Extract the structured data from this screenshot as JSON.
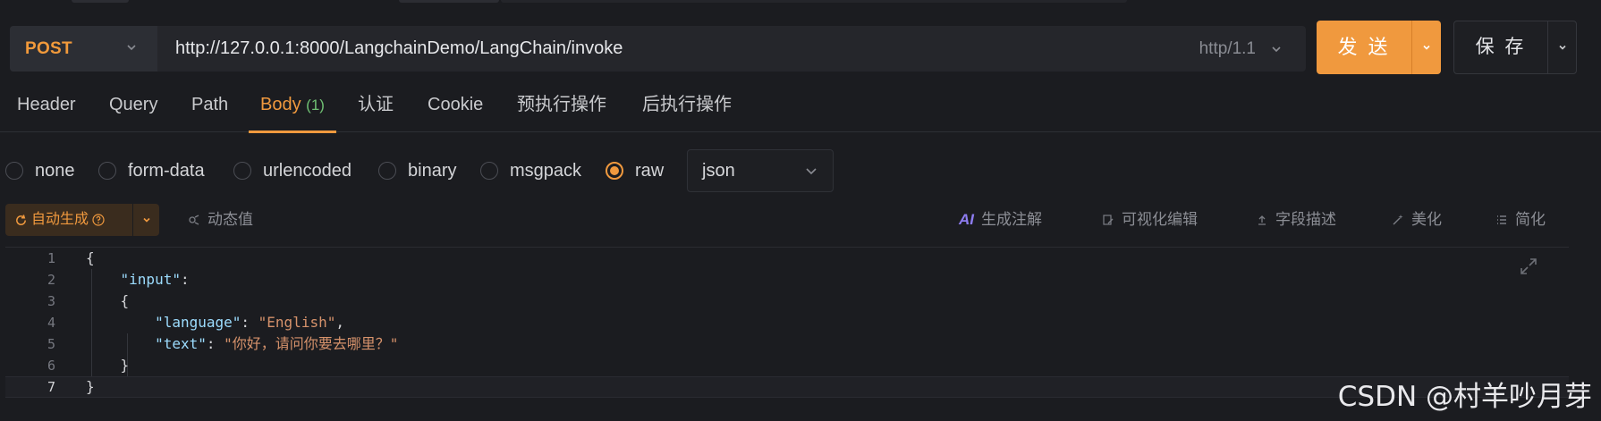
{
  "request": {
    "method": "POST",
    "url": "http://127.0.0.1:8000/LangchainDemo/LangChain/invoke",
    "protocol": "http/1.1",
    "send_label": "发 送",
    "save_label": "保 存"
  },
  "tabs": [
    {
      "label": "Header"
    },
    {
      "label": "Query"
    },
    {
      "label": "Path"
    },
    {
      "label": "Body",
      "count": "(1)",
      "active": true
    },
    {
      "label": "认证"
    },
    {
      "label": "Cookie"
    },
    {
      "label": "预执行操作"
    },
    {
      "label": "后执行操作"
    }
  ],
  "body_types": [
    {
      "label": "none"
    },
    {
      "label": "form-data"
    },
    {
      "label": "urlencoded"
    },
    {
      "label": "binary"
    },
    {
      "label": "msgpack"
    },
    {
      "label": "raw",
      "selected": true
    }
  ],
  "format_select": "json",
  "toolbar": {
    "auto_generate": "自动生成",
    "dynamic_value": "动态值",
    "ai_label": "AI",
    "generate_comment": "生成注解",
    "visual_edit": "可视化编辑",
    "field_desc": "字段描述",
    "beautify": "美化",
    "simplify": "简化"
  },
  "editor": {
    "line_numbers": [
      "1",
      "2",
      "3",
      "4",
      "5",
      "6",
      "7"
    ],
    "lines": [
      {
        "indent": "",
        "parts": [
          {
            "t": "{",
            "c": "p"
          }
        ]
      },
      {
        "indent": "    ",
        "parts": [
          {
            "t": "\"input\"",
            "c": "k"
          },
          {
            "t": ":",
            "c": "p"
          }
        ]
      },
      {
        "indent": "    ",
        "parts": [
          {
            "t": "{",
            "c": "p"
          }
        ]
      },
      {
        "indent": "        ",
        "parts": [
          {
            "t": "\"language\"",
            "c": "k"
          },
          {
            "t": ": ",
            "c": "p"
          },
          {
            "t": "\"English\"",
            "c": "s"
          },
          {
            "t": ",",
            "c": "p"
          }
        ]
      },
      {
        "indent": "        ",
        "parts": [
          {
            "t": "\"text\"",
            "c": "k"
          },
          {
            "t": ": ",
            "c": "p"
          },
          {
            "t": "\"你好，请问你要去哪里？\"",
            "c": "s"
          }
        ]
      },
      {
        "indent": "    ",
        "parts": [
          {
            "t": "}",
            "c": "p"
          }
        ]
      },
      {
        "indent": "",
        "parts": [
          {
            "t": "}",
            "c": "p"
          }
        ]
      }
    ]
  },
  "watermark": "CSDN @村羊吵月芽",
  "colors": {
    "accent": "#f0993e",
    "background": "#1b1c20",
    "key": "#9cdcfe",
    "string": "#d6926b"
  }
}
